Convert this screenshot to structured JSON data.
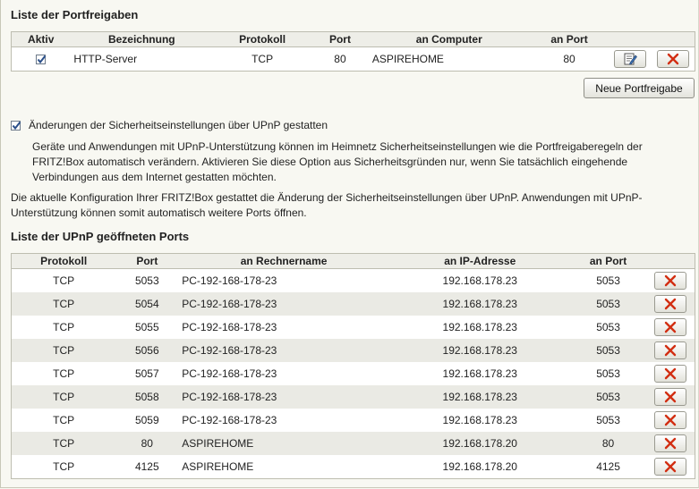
{
  "port_forwarding": {
    "title": "Liste der Portfreigaben",
    "headers": [
      "Aktiv",
      "Bezeichnung",
      "Protokoll",
      "Port",
      "an Computer",
      "an Port"
    ],
    "rows": [
      {
        "active": true,
        "name": "HTTP-Server",
        "protocol": "TCP",
        "port": "80",
        "computer": "ASPIREHOME",
        "to_port": "80"
      }
    ],
    "new_button": "Neue Portfreigabe"
  },
  "upnp": {
    "checkbox_checked": true,
    "checkbox_label": "Änderungen der Sicherheitseinstellungen über UPnP gestatten",
    "description": "Geräte und Anwendungen mit UPnP-Unterstützung können im Heimnetz Sicherheitseinstellungen wie die Portfreigaberegeln der FRITZ!Box automatisch verändern. Aktivieren Sie diese Option aus Sicherheitsgründen nur, wenn Sie tatsächlich eingehende Verbindungen aus dem Internet gestatten möchten.",
    "status": "Die aktuelle Konfiguration Ihrer FRITZ!Box gestattet die Änderung der Sicherheitseinstellungen über UPnP. Anwendungen mit UPnP-Unterstützung können somit automatisch weitere Ports öffnen."
  },
  "upnp_ports": {
    "title": "Liste der UPnP geöffneten Ports",
    "headers": [
      "Protokoll",
      "Port",
      "an Rechnername",
      "an IP-Adresse",
      "an Port"
    ],
    "rows": [
      {
        "protocol": "TCP",
        "port": "5053",
        "host": "PC-192-168-178-23",
        "ip": "192.168.178.23",
        "to_port": "5053"
      },
      {
        "protocol": "TCP",
        "port": "5054",
        "host": "PC-192-168-178-23",
        "ip": "192.168.178.23",
        "to_port": "5053"
      },
      {
        "protocol": "TCP",
        "port": "5055",
        "host": "PC-192-168-178-23",
        "ip": "192.168.178.23",
        "to_port": "5053"
      },
      {
        "protocol": "TCP",
        "port": "5056",
        "host": "PC-192-168-178-23",
        "ip": "192.168.178.23",
        "to_port": "5053"
      },
      {
        "protocol": "TCP",
        "port": "5057",
        "host": "PC-192-168-178-23",
        "ip": "192.168.178.23",
        "to_port": "5053"
      },
      {
        "protocol": "TCP",
        "port": "5058",
        "host": "PC-192-168-178-23",
        "ip": "192.168.178.23",
        "to_port": "5053"
      },
      {
        "protocol": "TCP",
        "port": "5059",
        "host": "PC-192-168-178-23",
        "ip": "192.168.178.23",
        "to_port": "5053"
      },
      {
        "protocol": "TCP",
        "port": "80",
        "host": "ASPIREHOME",
        "ip": "192.168.178.20",
        "to_port": "80"
      },
      {
        "protocol": "TCP",
        "port": "4125",
        "host": "ASPIREHOME",
        "ip": "192.168.178.20",
        "to_port": "4125"
      }
    ]
  },
  "colors": {
    "delete_red": "#d22e12",
    "row_alt": "#eaeae4",
    "header_bg": "#eeeee8"
  },
  "icons": {
    "edit": "edit-icon",
    "delete": "delete-icon",
    "check": "checkmark-icon"
  }
}
